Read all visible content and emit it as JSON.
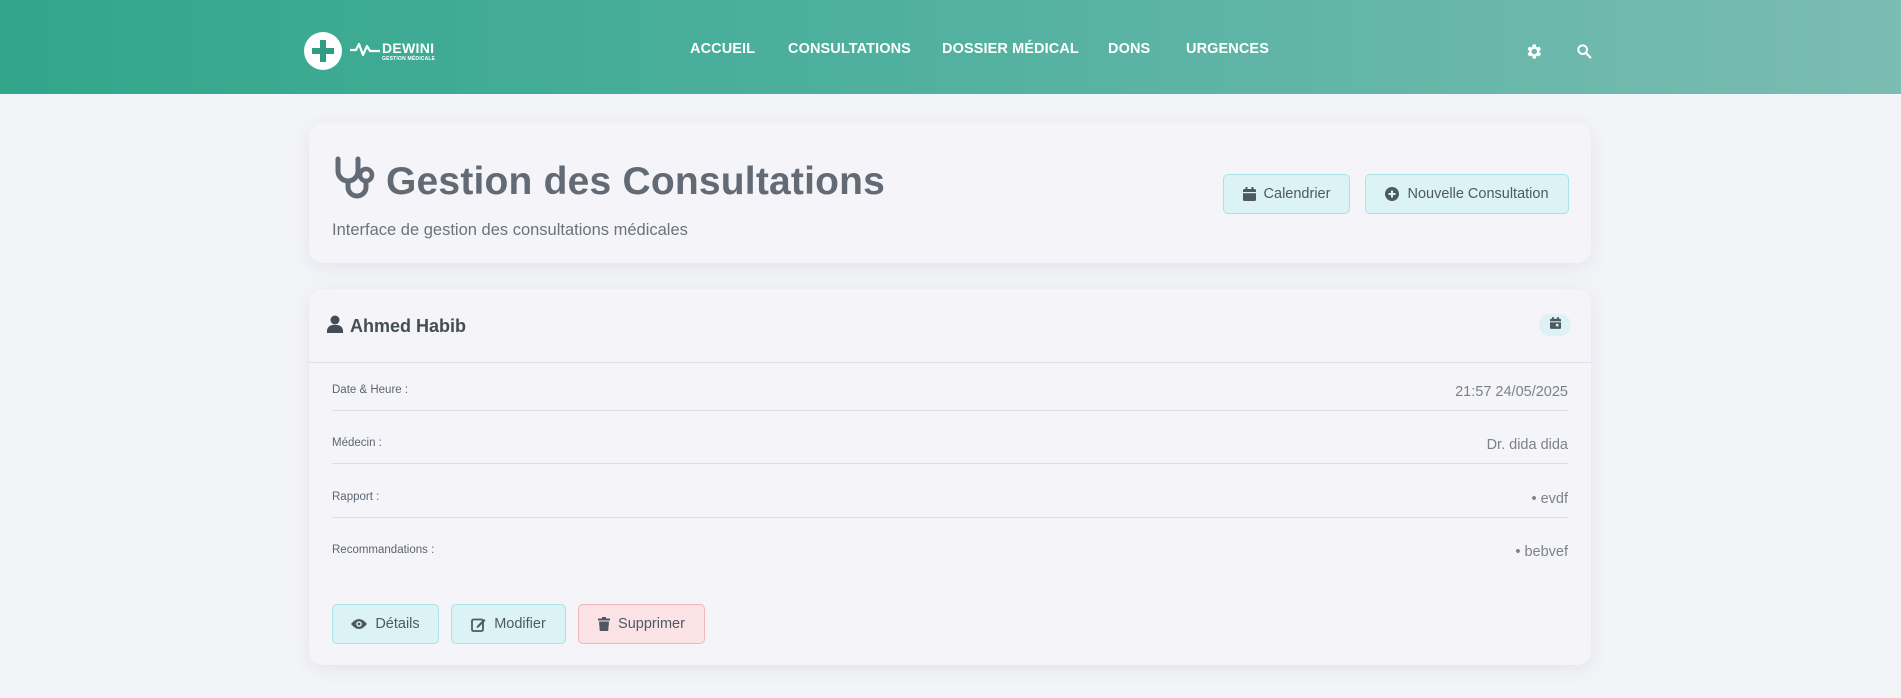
{
  "brand": {
    "name": "DEWINI",
    "tagline": "GESTION MÉDICALE"
  },
  "nav": {
    "items": [
      "ACCUEIL",
      "CONSULTATIONS",
      "DOSSIER MÉDICAL",
      "DONS",
      "URGENCES"
    ]
  },
  "header_icons": [
    "gear-icon",
    "search-icon"
  ],
  "page": {
    "title": "Gestion des Consultations",
    "subtitle": "Interface de gestion des consultations médicales",
    "title_icon": "stethoscope-icon"
  },
  "actions": {
    "calendar": "Calendrier",
    "new": "Nouvelle Consultation"
  },
  "consultation": {
    "patient": "Ahmed Habib",
    "fields": [
      {
        "label": "Date & Heure :",
        "value": "21:57 24/05/2025"
      },
      {
        "label": "Médecin :",
        "value": "Dr. dida dida"
      },
      {
        "label": "Rapport :",
        "value": "• evdf"
      },
      {
        "label": "Recommandations :",
        "value": "• bebvef"
      }
    ],
    "buttons": {
      "details": "Détails",
      "edit": "Modifier",
      "delete": "Supprimer"
    }
  },
  "colors": {
    "header_start": "#31a68b",
    "header_end": "#7bbcb3",
    "info_bg": "#dbf3f5",
    "danger_bg": "#fbe2e4"
  }
}
